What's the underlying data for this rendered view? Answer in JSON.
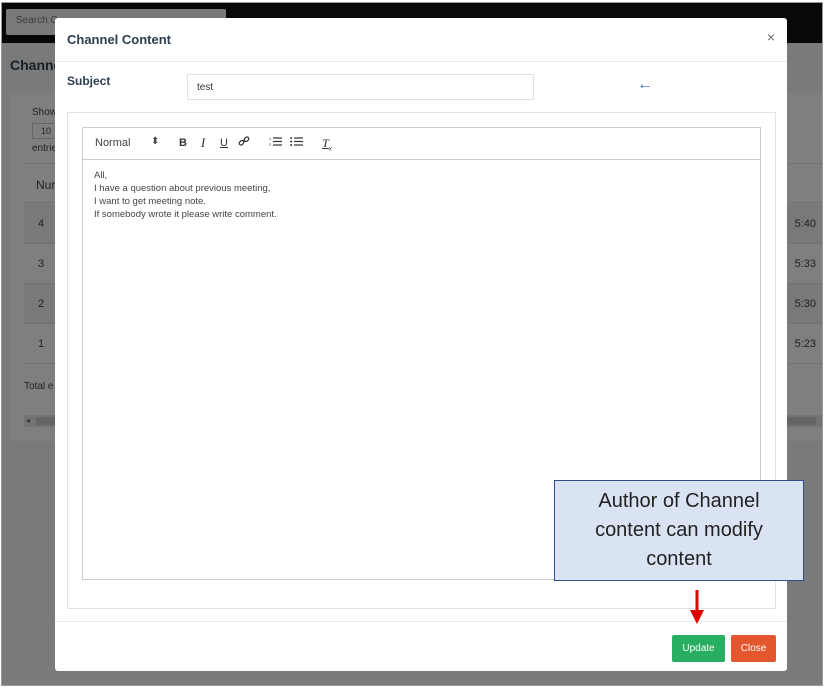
{
  "background": {
    "search_text": "Search C",
    "page_title": "Channe",
    "show_label": "Show",
    "page_length": "10",
    "entries_label": "entrie",
    "col_header": "Nur",
    "rows": [
      {
        "num": "4",
        "time": "5:40"
      },
      {
        "num": "3",
        "time": "5:33"
      },
      {
        "num": "2",
        "time": "5:30"
      },
      {
        "num": "1",
        "time": "5:23"
      }
    ],
    "total_label": "Total e",
    "scroll_arrow": "◂"
  },
  "modal": {
    "title": "Channel Content",
    "close_glyph": "×",
    "subject_label": "Subject",
    "subject_value": "test",
    "arrow_glyph": "←",
    "toolbar": {
      "header_select": "Normal",
      "caret": "⬍",
      "bold": "B",
      "italic": "I",
      "underline": "U",
      "link": "🔗",
      "ordered_list": "☰",
      "bullet_list": "☰",
      "clean": "T"
    },
    "content_lines": [
      "All,",
      "I have a question about previous meeting,",
      "I want to get meeting note.",
      "If somebody wrote it please write comment."
    ],
    "update_label": "Update",
    "close_label": "Close"
  },
  "annotation": {
    "text_line1": "Author of Channel",
    "text_line2": "content can modify",
    "text_line3": "content"
  },
  "colors": {
    "update": "#27ae60",
    "close": "#e4572e",
    "callout_bg": "#dae3f3",
    "callout_border": "#2f528f",
    "arrow_red": "#e00000",
    "arrow_blue": "#3b6fd6"
  },
  "icons": [
    "link-icon",
    "ordered-list-icon",
    "bullet-list-icon",
    "clear-format-icon",
    "close-icon",
    "arrow-left-icon",
    "arrow-down-icon"
  ]
}
